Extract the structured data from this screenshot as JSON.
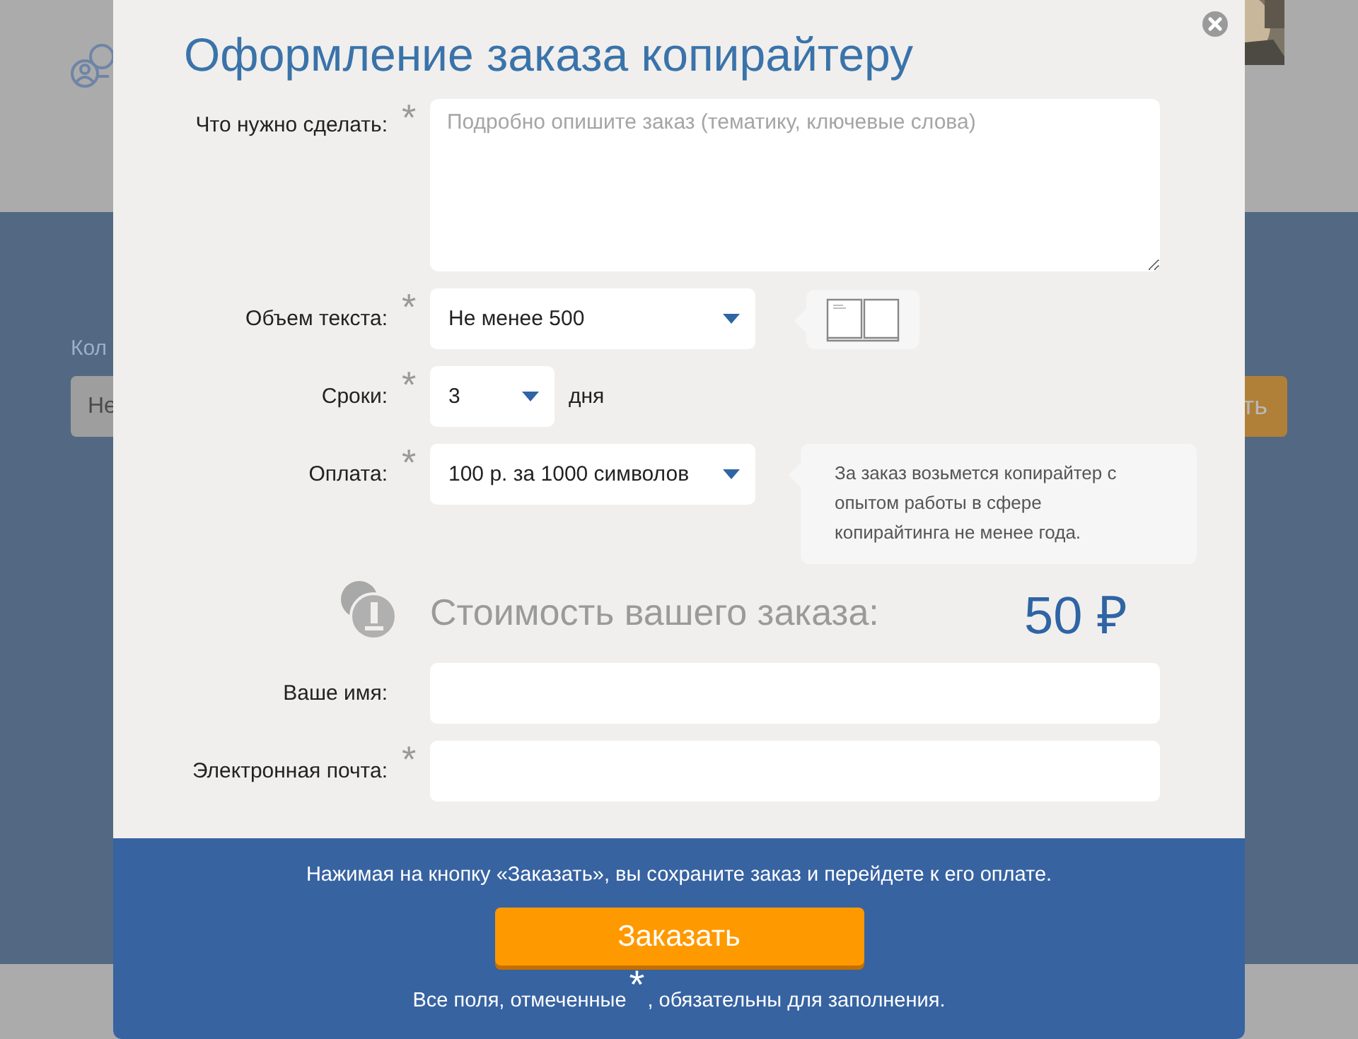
{
  "background": {
    "label": "Кол",
    "field_value": "Не",
    "button": "ть"
  },
  "dialog": {
    "title": "Оформление заказа копирайтеру",
    "fields": [
      {
        "kind": "textarea",
        "label": "Что нужно сделать:",
        "required": true,
        "placeholder": "Подробно опишите заказ (тематику, ключевые слова)"
      },
      {
        "kind": "select",
        "label": "Объем текста:",
        "required": true,
        "value": "Не менее 500",
        "hint": {
          "kind": "book"
        }
      },
      {
        "kind": "select",
        "label": "Сроки:",
        "required": true,
        "value": "3",
        "unit": "дня"
      },
      {
        "kind": "select",
        "label": "Оплата:",
        "required": true,
        "value": "100 р. за 1000 символов",
        "hint": {
          "kind": "text",
          "text": "За заказ возьмется копирайтер с опытом работы в сфере копирайтинга не менее года."
        }
      },
      {
        "kind": "cost",
        "label": "Стоимость вашего заказа:",
        "value": "50 ₽"
      },
      {
        "kind": "input",
        "label": "Ваше имя:",
        "required": false
      },
      {
        "kind": "input",
        "label": "Электронная почта:",
        "required": true
      }
    ],
    "footer": {
      "note": "Нажимая на кнопку «Заказать», вы сохраните заказ и перейдете к его оплате.",
      "button": "Заказать",
      "required_note_before": "Все поля, отмеченные",
      "required_mark": "*",
      "required_note_after": ", обязательны для заполнения."
    }
  }
}
